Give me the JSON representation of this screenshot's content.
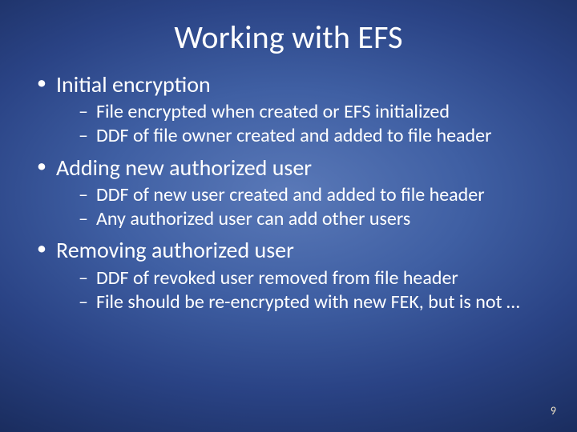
{
  "title": "Working with EFS",
  "bullets": [
    {
      "text": "Initial encryption",
      "sub": [
        "File encrypted when created or EFS initialized",
        "DDF of file owner created and added to file header"
      ]
    },
    {
      "text": "Adding new authorized user",
      "sub": [
        "DDF of new user created and added to file header",
        "Any authorized user can add other users"
      ]
    },
    {
      "text": "Removing authorized user",
      "sub": [
        "DDF of revoked user removed from file header",
        "File should be re-encrypted with new FEK, but is not …"
      ]
    }
  ],
  "page_number": "9"
}
